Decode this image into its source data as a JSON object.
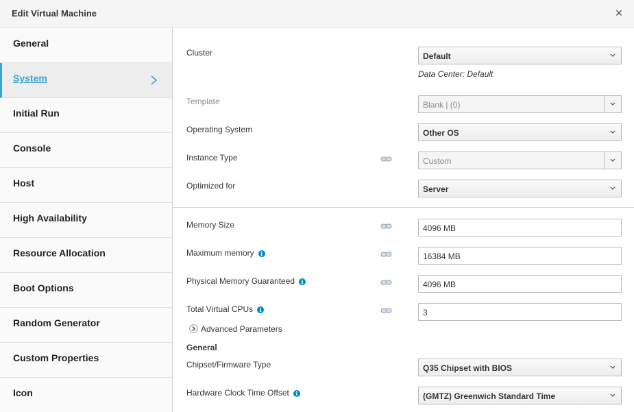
{
  "dialog": {
    "title": "Edit Virtual Machine",
    "close_glyph": "×"
  },
  "sidebar": {
    "items": [
      {
        "label": "General"
      },
      {
        "label": "System",
        "active": true
      },
      {
        "label": "Initial Run"
      },
      {
        "label": "Console"
      },
      {
        "label": "Host"
      },
      {
        "label": "High Availability"
      },
      {
        "label": "Resource Allocation"
      },
      {
        "label": "Boot Options"
      },
      {
        "label": "Random Generator"
      },
      {
        "label": "Custom Properties"
      },
      {
        "label": "Icon"
      }
    ]
  },
  "form": {
    "cluster": {
      "label": "Cluster",
      "value": "Default",
      "note": "Data Center: Default"
    },
    "template": {
      "label": "Template",
      "value": "Blank |  (0)"
    },
    "operating_system": {
      "label": "Operating System",
      "value": "Other OS"
    },
    "instance_type": {
      "label": "Instance Type",
      "value": "Custom"
    },
    "optimized_for": {
      "label": "Optimized for",
      "value": "Server"
    },
    "memory_size": {
      "label": "Memory Size",
      "value": "4096 MB"
    },
    "maximum_memory": {
      "label": "Maximum memory",
      "value": "16384 MB"
    },
    "physical_memory": {
      "label": "Physical Memory Guaranteed",
      "value": "4096 MB"
    },
    "total_vcpus": {
      "label": "Total Virtual CPUs",
      "value": "3"
    },
    "advanced_parameters": {
      "label": "Advanced Parameters"
    },
    "general_section": {
      "title": "General"
    },
    "chipset": {
      "label": "Chipset/Firmware Type",
      "value": "Q35 Chipset with BIOS"
    },
    "clock_offset": {
      "label": "Hardware Clock Time Offset",
      "value": "(GMTZ) Greenwich Standard Time"
    }
  },
  "colors": {
    "accent": "#39a5dc",
    "info": "#0088ce"
  },
  "icons": {
    "info": "i"
  }
}
